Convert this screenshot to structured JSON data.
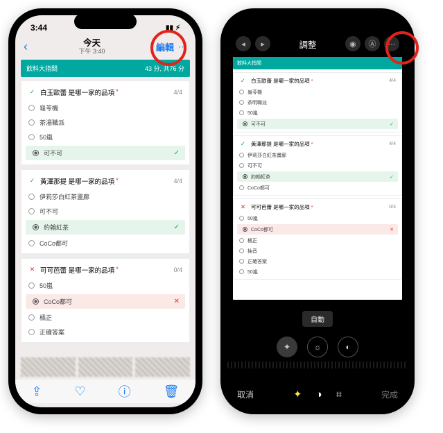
{
  "left": {
    "status_time": "3:44",
    "nav_title": "今天",
    "nav_subtitle": "下午 3:40",
    "edit_label": "編輯",
    "quiz": {
      "title": "飲料大指間",
      "meta": "43 分, 共76 分"
    },
    "q1": {
      "title": "白玉歐蕾 是哪一家的品項",
      "score": "4/4",
      "o1": "龜苓機",
      "o2": "茶湯職派",
      "o3": "50嵐",
      "o4": "可不可"
    },
    "q2": {
      "title": "黃澤那提 是哪一家的品項",
      "score": "4/4",
      "o1": "伊莉莎白紅茶畫廊",
      "o2": "可不可",
      "o3": "約翰紅茶",
      "o4": "CoCo都可"
    },
    "q3": {
      "title": "可可芭蕾 是哪一家的品項",
      "score": "0/4",
      "o1": "50嵐",
      "o2": "CoCo都可",
      "o3": "橘正",
      "o4": "正確答案"
    }
  },
  "right": {
    "title": "調整",
    "auto_label": "自動",
    "cancel": "取消",
    "done": "完成",
    "quiz": {
      "title": "飲料大指間"
    },
    "q1": {
      "title": "白玉歐蕾 是哪一家的品項",
      "score": "4/4",
      "o1": "龜苓機",
      "o2": "茶明職派",
      "o3": "50嵐",
      "o4": "可不可"
    },
    "q2": {
      "title": "黃澤那提 是哪一家的品項",
      "score": "4/4",
      "o1": "伊莉莎白紅茶畫廊",
      "o2": "可不可",
      "o3": "約翰紅茶",
      "o4": "CoCo都可"
    },
    "q3": {
      "title": "可可芭蕾 是哪一家的品項",
      "score": "0/4",
      "o1": "50嵐",
      "o2": "CoCo都可",
      "o3": "橘正",
      "o4": "抽音",
      "o5": "正確答案",
      "o6": "50嵐"
    }
  }
}
